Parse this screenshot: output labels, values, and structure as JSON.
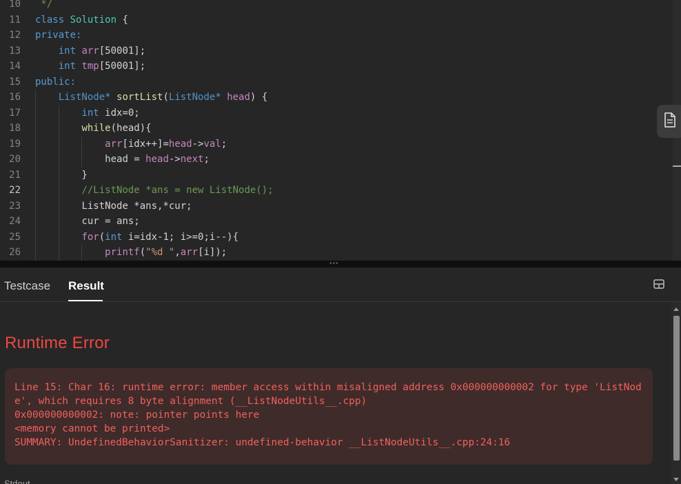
{
  "editor": {
    "lines": [
      {
        "num": "10",
        "tokens": [
          {
            "t": " */",
            "c": "cm"
          }
        ]
      },
      {
        "num": "11",
        "tokens": [
          {
            "t": "class ",
            "c": "kw"
          },
          {
            "t": "Solution",
            "c": "cls"
          },
          {
            "t": " {",
            "c": "p"
          }
        ]
      },
      {
        "num": "12",
        "tokens": [
          {
            "t": "private:",
            "c": "kw"
          }
        ]
      },
      {
        "num": "13",
        "tokens": [
          {
            "t": "    ",
            "c": "p"
          },
          {
            "t": "int ",
            "c": "kw"
          },
          {
            "t": "arr",
            "c": "vr"
          },
          {
            "t": "[50001];",
            "c": "p"
          }
        ]
      },
      {
        "num": "14",
        "tokens": [
          {
            "t": "    ",
            "c": "p"
          },
          {
            "t": "int ",
            "c": "kw"
          },
          {
            "t": "tmp",
            "c": "vr"
          },
          {
            "t": "[50001];",
            "c": "p"
          }
        ]
      },
      {
        "num": "15",
        "tokens": [
          {
            "t": "public:",
            "c": "kw"
          }
        ]
      },
      {
        "num": "16",
        "tokens": [
          {
            "t": "    ",
            "c": "p"
          },
          {
            "t": "ListNode",
            "c": "typ"
          },
          {
            "t": "* ",
            "c": "kw"
          },
          {
            "t": "sortList",
            "c": "fn"
          },
          {
            "t": "(",
            "c": "p"
          },
          {
            "t": "ListNode",
            "c": "typ"
          },
          {
            "t": "* ",
            "c": "kw"
          },
          {
            "t": "head",
            "c": "vr"
          },
          {
            "t": ") {",
            "c": "p"
          }
        ]
      },
      {
        "num": "17",
        "tokens": [
          {
            "t": "        ",
            "c": "p"
          },
          {
            "t": "int ",
            "c": "kw"
          },
          {
            "t": "idx=0;",
            "c": "p"
          }
        ]
      },
      {
        "num": "18",
        "tokens": [
          {
            "t": "        ",
            "c": "p"
          },
          {
            "t": "while",
            "c": "fn"
          },
          {
            "t": "(head){",
            "c": "p"
          }
        ]
      },
      {
        "num": "19",
        "tokens": [
          {
            "t": "            ",
            "c": "p"
          },
          {
            "t": "arr",
            "c": "vr"
          },
          {
            "t": "[idx++]=",
            "c": "p"
          },
          {
            "t": "head",
            "c": "vr"
          },
          {
            "t": "->",
            "c": "p"
          },
          {
            "t": "val",
            "c": "vr"
          },
          {
            "t": ";",
            "c": "p"
          }
        ]
      },
      {
        "num": "20",
        "tokens": [
          {
            "t": "            ",
            "c": "p"
          },
          {
            "t": "head = ",
            "c": "p"
          },
          {
            "t": "head",
            "c": "vr"
          },
          {
            "t": "->",
            "c": "p"
          },
          {
            "t": "next",
            "c": "vr"
          },
          {
            "t": ";",
            "c": "p"
          }
        ]
      },
      {
        "num": "21",
        "tokens": [
          {
            "t": "        }",
            "c": "p"
          }
        ]
      },
      {
        "num": "22",
        "tokens": [
          {
            "t": "        ",
            "c": "p"
          },
          {
            "t": "//ListNode *ans = new ListNode();",
            "c": "cm"
          }
        ],
        "active": true
      },
      {
        "num": "23",
        "tokens": [
          {
            "t": "        ",
            "c": "p"
          },
          {
            "t": "ListNode *ans,*cur;",
            "c": "p"
          }
        ]
      },
      {
        "num": "24",
        "tokens": [
          {
            "t": "        ",
            "c": "p"
          },
          {
            "t": "cur = ans;",
            "c": "p"
          }
        ]
      },
      {
        "num": "25",
        "tokens": [
          {
            "t": "        ",
            "c": "p"
          },
          {
            "t": "for",
            "c": "vr"
          },
          {
            "t": "(",
            "c": "p"
          },
          {
            "t": "int ",
            "c": "kw"
          },
          {
            "t": "i=idx-1; i>=0;i--){",
            "c": "p"
          }
        ]
      },
      {
        "num": "26",
        "tokens": [
          {
            "t": "            ",
            "c": "p"
          },
          {
            "t": "printf",
            "c": "vr"
          },
          {
            "t": "(",
            "c": "p"
          },
          {
            "t": "\"%d \"",
            "c": "str"
          },
          {
            "t": ",",
            "c": "p"
          },
          {
            "t": "arr",
            "c": "vr"
          },
          {
            "t": "[i]);",
            "c": "p"
          }
        ]
      }
    ]
  },
  "splitter": {
    "dots": "•••"
  },
  "panel": {
    "tabs": [
      {
        "label": "Testcase",
        "active": false
      },
      {
        "label": "Result",
        "active": true
      }
    ],
    "result_title": "Runtime Error",
    "error_lines": [
      "Line 15: Char 16: runtime error: member access within misaligned address 0x000000000002 for type 'ListNode', which requires 8 byte alignment (__ListNodeUtils__.cpp)",
      "0x000000000002: note: pointer points here",
      "<memory cannot be printed>",
      "SUMMARY: UndefinedBehaviorSanitizer: undefined-behavior __ListNodeUtils__.cpp:24:16"
    ],
    "stdout_label": "Stdout"
  },
  "colors": {
    "error_red": "#ef4743",
    "error_box_bg": "#3f2b2a",
    "editor_bg": "#262626"
  },
  "icons": {
    "side_button": "document-icon",
    "panel_layout": "layout-icon"
  }
}
